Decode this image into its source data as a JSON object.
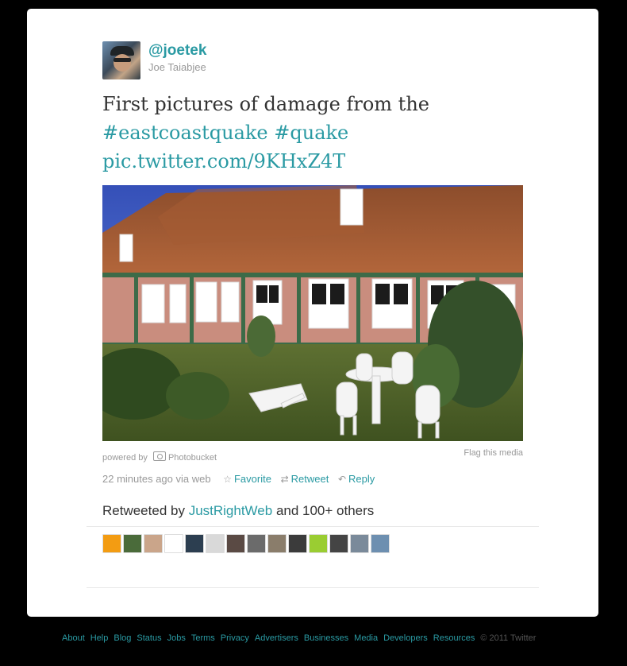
{
  "tweet": {
    "screen_name": "@joetek",
    "real_name": "Joe Taiabjee",
    "text_plain": "First pictures of damage from the",
    "hashtag_1": "#eastcoastquake",
    "hashtag_2": "#quake",
    "link": "pic.twitter.com/9KHxZ4T",
    "powered_by_label": "powered by",
    "photo_provider": "Photobucket",
    "flag_media": "Flag this media",
    "timestamp": "22 minutes ago via web",
    "actions": {
      "favorite": "Favorite",
      "retweet": "Retweet",
      "reply": "Reply"
    },
    "retweeted_by_prefix": "Retweeted by",
    "retweeted_by_user": "JustRightWeb",
    "retweeted_by_suffix": "and 100+ others"
  },
  "retweeter_colors": [
    "#f39c12",
    "#4a6b3a",
    "#caa58a",
    "#ffffff",
    "#2c3e50",
    "#d9d9d9",
    "#5a4a44",
    "#6b6b6b",
    "#8a7d6b",
    "#3b3b3b",
    "#9acd32",
    "#444444",
    "#7a8a9a",
    "#6d8fb0"
  ],
  "footer": {
    "links": [
      "About",
      "Help",
      "Blog",
      "Status",
      "Jobs",
      "Terms",
      "Privacy",
      "Advertisers",
      "Businesses",
      "Media",
      "Developers",
      "Resources"
    ],
    "copyright": "© 2011 Twitter"
  }
}
